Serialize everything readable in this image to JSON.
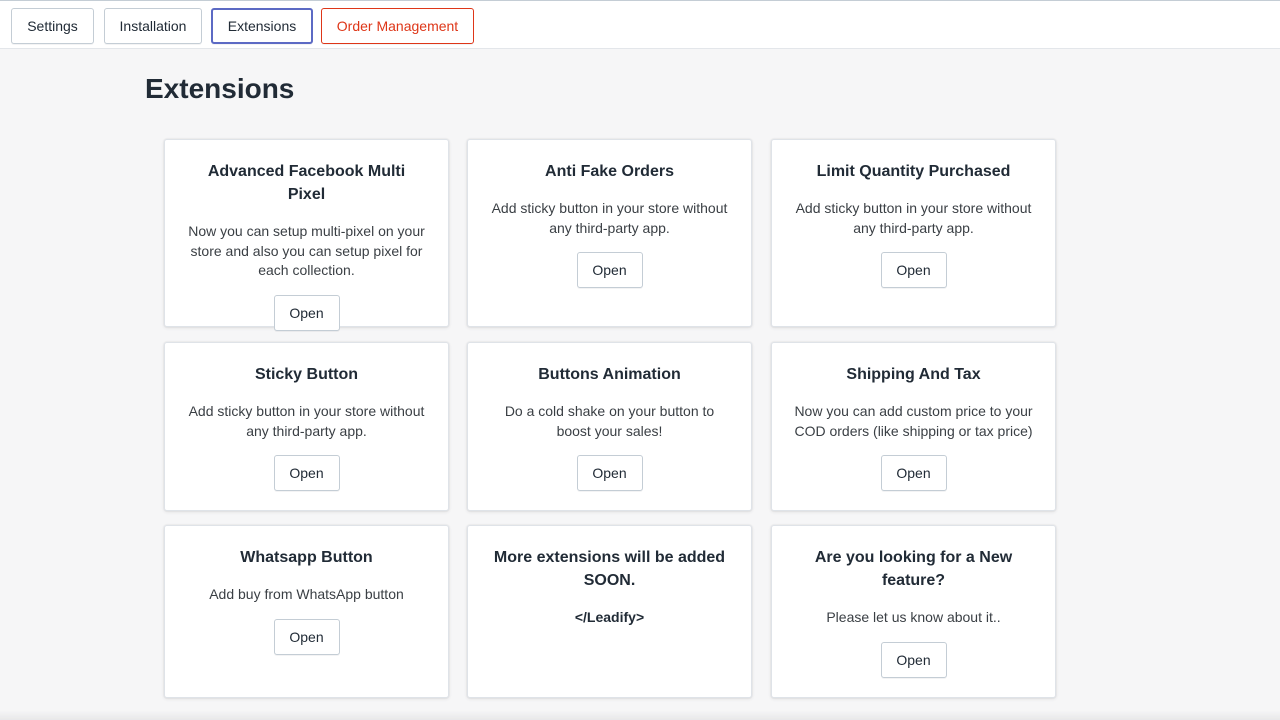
{
  "nav": {
    "settings": "Settings",
    "installation": "Installation",
    "extensions": "Extensions",
    "order_management": "Order Management"
  },
  "page": {
    "title": "Extensions"
  },
  "colors": {
    "active_border": "#5c6ac4",
    "danger": "#de3618",
    "background": "#f6f6f7"
  },
  "cards": [
    {
      "title": "Advanced Facebook Multi Pixel",
      "description": "Now you can setup multi-pixel on your store and also you can setup pixel for each collection.",
      "button": "Open"
    },
    {
      "title": "Anti Fake Orders",
      "description": "Add sticky button in your store without any third-party app.",
      "button": "Open"
    },
    {
      "title": "Limit Quantity Purchased",
      "description": "Add sticky button in your store without any third-party app.",
      "button": "Open"
    },
    {
      "title": "Sticky Button",
      "description": "Add sticky button in your store without any third-party app.",
      "button": "Open"
    },
    {
      "title": "Buttons Animation",
      "description": "Do a cold shake on your button to boost your sales!",
      "button": "Open"
    },
    {
      "title": "Shipping And Tax",
      "description": "Now you can add custom price to your COD orders (like shipping or tax price)",
      "button": "Open"
    },
    {
      "title": "Whatsapp Button",
      "description": "Add buy from WhatsApp button",
      "button": "Open"
    },
    {
      "title": "More extensions will be added SOON.",
      "description": "</Leadify>"
    },
    {
      "title": "Are you looking for a New feature?",
      "description": "Please let us know about it..",
      "button": "Open"
    }
  ]
}
